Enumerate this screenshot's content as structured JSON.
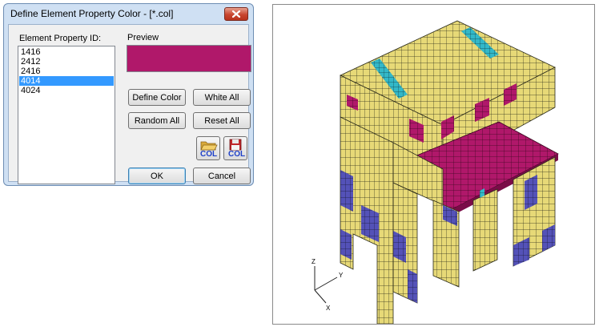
{
  "dialog": {
    "title": "Define Element Property Color - [*.col]",
    "list_label": "Element Property ID:",
    "items": [
      "1416",
      "2412",
      "2416",
      "4014",
      "4024"
    ],
    "selected_index": 3,
    "preview_label": "Preview",
    "preview_color": "#b0186a",
    "buttons": {
      "define_color": "Define Color",
      "white_all": "White All",
      "random_all": "Random All",
      "reset_all": "Reset All",
      "ok": "OK",
      "cancel": "Cancel"
    },
    "icons": {
      "open_col": {
        "icon": "folder-open-icon",
        "label": "COL"
      },
      "save_col": {
        "icon": "floppy-save-icon",
        "label": "COL"
      }
    }
  },
  "viewport": {
    "axes": {
      "x": "X",
      "y": "Y",
      "z": "Z"
    },
    "colors": {
      "yellow": "#e7d977",
      "magenta": "#b0186a",
      "blue": "#5452b8",
      "cyan": "#33b8c8",
      "mesh": "#2a2a1a"
    }
  }
}
